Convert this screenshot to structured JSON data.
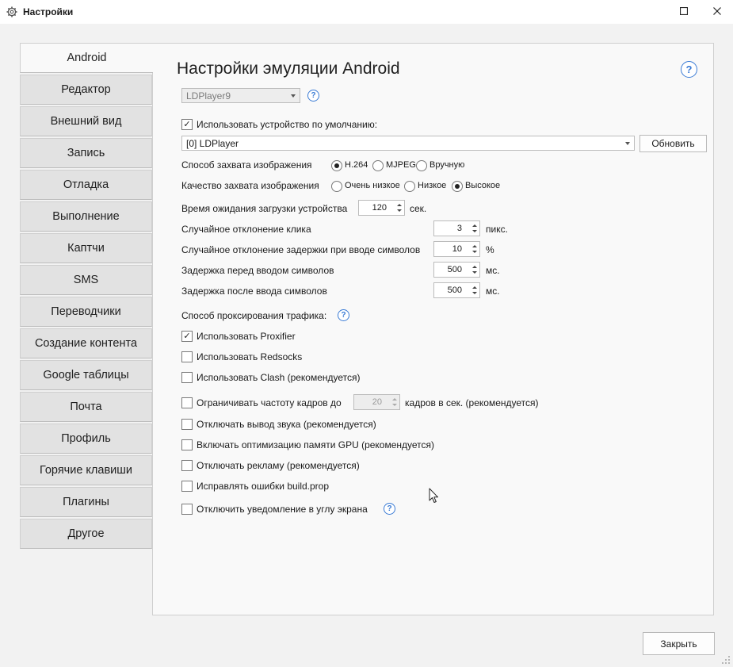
{
  "window": {
    "title": "Настройки",
    "app_icon": "gear-icon",
    "maximize_icon": "maximize-icon",
    "close_icon": "close-icon"
  },
  "sidebar": {
    "items": [
      {
        "label": "Android",
        "active": true
      },
      {
        "label": "Редактор"
      },
      {
        "label": "Внешний вид"
      },
      {
        "label": "Запись"
      },
      {
        "label": "Отладка"
      },
      {
        "label": "Выполнение"
      },
      {
        "label": "Каптчи"
      },
      {
        "label": "SMS"
      },
      {
        "label": "Переводчики"
      },
      {
        "label": "Создание контента"
      },
      {
        "label": "Google таблицы"
      },
      {
        "label": "Почта"
      },
      {
        "label": "Профиль"
      },
      {
        "label": "Горячие клавиши"
      },
      {
        "label": "Плагины"
      },
      {
        "label": "Другое"
      }
    ]
  },
  "main": {
    "title": "Настройки эмуляции Android",
    "help_icon": "help-icon",
    "emulator_select": "LDPlayer9",
    "use_default_device": {
      "label": "Использовать устройство по умолчанию:",
      "checked": true
    },
    "device_select": "[0] LDPlayer",
    "refresh_button": "Обновить",
    "capture_method": {
      "label": "Способ захвата изображения",
      "options": [
        {
          "label": "H.264",
          "selected": true
        },
        {
          "label": "MJPEG",
          "selected": false
        },
        {
          "label": "Вручную",
          "selected": false
        }
      ]
    },
    "capture_quality": {
      "label": "Качество захвата изображения",
      "options": [
        {
          "label": "Очень низкое",
          "selected": false
        },
        {
          "label": "Низкое",
          "selected": false
        },
        {
          "label": "Высокое",
          "selected": true
        }
      ]
    },
    "load_timeout": {
      "label": "Время ожидания загрузки устройства",
      "value": "120",
      "unit": "сек."
    },
    "click_deviation": {
      "label": "Случайное отклонение клика",
      "value": "3",
      "unit": "пикс."
    },
    "typing_delay_deviation": {
      "label": "Случайное отклонение задержки при вводе символов",
      "value": "10",
      "unit": "%"
    },
    "delay_before_typing": {
      "label": "Задержка перед вводом символов",
      "value": "500",
      "unit": "мс."
    },
    "delay_after_typing": {
      "label": "Задержка после ввода символов",
      "value": "500",
      "unit": "мс."
    },
    "proxy_method_label": "Способ проксирования трафика:",
    "proxy_options": [
      {
        "label": "Использовать Proxifier",
        "checked": true
      },
      {
        "label": "Использовать Redsocks",
        "checked": false
      },
      {
        "label": "Использовать Clash (рекомендуется)",
        "checked": false
      }
    ],
    "limit_fps": {
      "label": "Ограничивать частоту кадров до",
      "value": "20",
      "suffix": "кадров в сек. (рекомендуется)",
      "checked": false
    },
    "options": [
      {
        "label": "Отключать вывод звука (рекомендуется)",
        "checked": false
      },
      {
        "label": "Включать оптимизацию памяти GPU (рекомендуется)",
        "checked": false
      },
      {
        "label": "Отключать рекламу (рекомендуется)",
        "checked": false
      },
      {
        "label": "Исправлять ошибки build.prop",
        "checked": false
      },
      {
        "label": "Отключить уведомление в углу экрана",
        "checked": false
      }
    ]
  },
  "footer": {
    "close_button": "Закрыть"
  }
}
